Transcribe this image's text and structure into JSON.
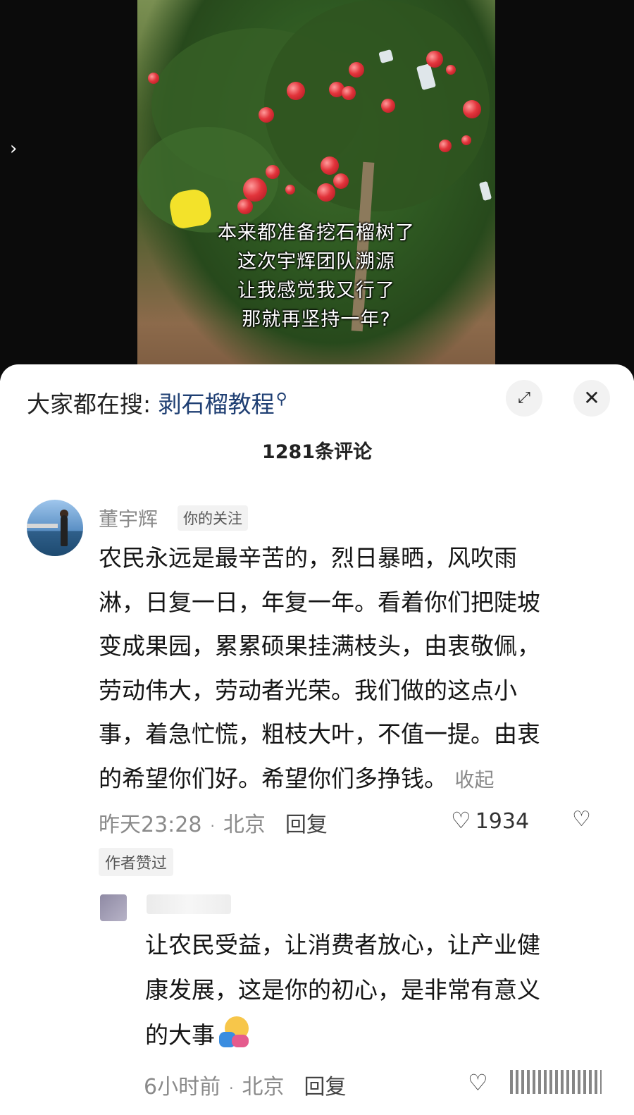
{
  "video": {
    "caption_lines": [
      "本来都准备挖石榴树了",
      "这次宇辉团队溯源",
      "让我感觉我又行了",
      "那就再坚持一年?"
    ],
    "side_arrow": "›"
  },
  "sheet": {
    "search_prefix": "大家都在搜:",
    "search_keyword": "剥石榴教程",
    "search_icon": "⚲",
    "expand_icon": "⤢",
    "close_icon": "✕",
    "comment_count": "1281条评论"
  },
  "comment": {
    "author": "董宇辉",
    "follow_tag": "你的关注",
    "lines": [
      "农民永远是最辛苦的，烈日暴晒，风吹雨",
      "淋，日复一日，年复一年。看着你们把陡坡",
      "变成果园，累累硕果挂满枝头，由衷敬佩，",
      "劳动伟大，劳动者光荣。我们做的这点小",
      "事，着急忙慌，粗枝大叶，不值一提。由衷",
      "的希望你们好。希望你们多挣钱。"
    ],
    "collapse_label": "收起",
    "time": "昨天23:28",
    "location": "北京",
    "reply_label": "回复",
    "likes": "1934",
    "author_liked": "作者赞过"
  },
  "reply": {
    "lines": [
      "让农民受益，让消费者放心，让产业健",
      "康发展，这是你的初心，是非常有意义",
      "的大事"
    ],
    "time": "6小时前",
    "location": "北京",
    "reply_label": "回复"
  },
  "icons": {
    "heart": "♡",
    "dislike": "♡"
  }
}
